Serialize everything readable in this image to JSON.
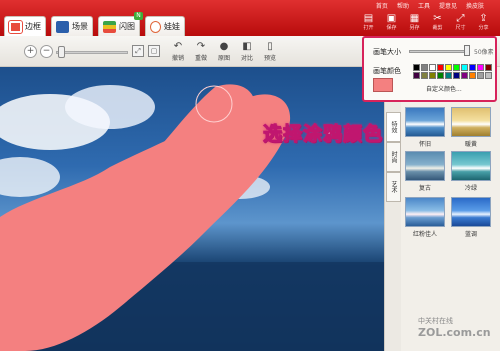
{
  "tabs": [
    {
      "label": "边框",
      "color": "#e84c3d",
      "active": true
    },
    {
      "label": "场景",
      "color": "#2b5fab"
    },
    {
      "label": "闪图",
      "color": "#3aa54a",
      "badge": "N"
    },
    {
      "label": "娃娃",
      "color": "#e0663a"
    }
  ],
  "top_links": [
    "首页",
    "帮助",
    "工具",
    "提意见",
    "换皮肤"
  ],
  "top_icons": [
    {
      "icon": "open-icon",
      "label": "打开"
    },
    {
      "icon": "save-icon",
      "label": "保存"
    },
    {
      "icon": "save-as-icon",
      "label": "另存"
    },
    {
      "icon": "cut-icon",
      "label": "裁剪"
    },
    {
      "icon": "resize-icon",
      "label": "尺寸"
    },
    {
      "icon": "share-icon",
      "label": "分享"
    }
  ],
  "toolbar": {
    "zoom_out": "−",
    "zoom_in": "+",
    "actions": [
      {
        "icon": "undo-icon",
        "label": "撤销"
      },
      {
        "icon": "redo-icon",
        "label": "重做"
      },
      {
        "icon": "original-icon",
        "label": "原图"
      },
      {
        "icon": "compare-icon",
        "label": "对比"
      },
      {
        "icon": "preview-icon",
        "label": "预览"
      }
    ]
  },
  "canvas": {
    "annotation": "选择涂鸦颜色"
  },
  "side_tabs": [
    "特效",
    "时尚",
    "艺术"
  ],
  "effects": [
    {
      "label": "怀旧"
    },
    {
      "label": "暖黄"
    },
    {
      "label": "复古"
    },
    {
      "label": "冷绿"
    },
    {
      "label": "红粉佳人"
    },
    {
      "label": "蓝调"
    }
  ],
  "brush_popup": {
    "size_label": "画笔大小",
    "size_value": "50像素",
    "size_fraction": 0.92,
    "color_label": "画笔颜色",
    "current_color": "#f48080",
    "custom_label": "自定义颜色...",
    "swatches": [
      "#000000",
      "#808080",
      "#ffffff",
      "#ff0000",
      "#ffff00",
      "#00ff00",
      "#00ffff",
      "#0000ff",
      "#ff00ff",
      "#800000",
      "#400040",
      "#808040",
      "#808000",
      "#008000",
      "#008080",
      "#000080",
      "#800080",
      "#ff8000",
      "#a0a0a0",
      "#c0c0c0"
    ]
  },
  "watermark": {
    "line1": "中关村在线",
    "line2": "ZOL.com.cn"
  },
  "colors": {
    "accent_red": "#c81414",
    "brush_pink": "#f48080",
    "annotation_magenta": "#c0166f",
    "popup_border": "#d7235b"
  }
}
